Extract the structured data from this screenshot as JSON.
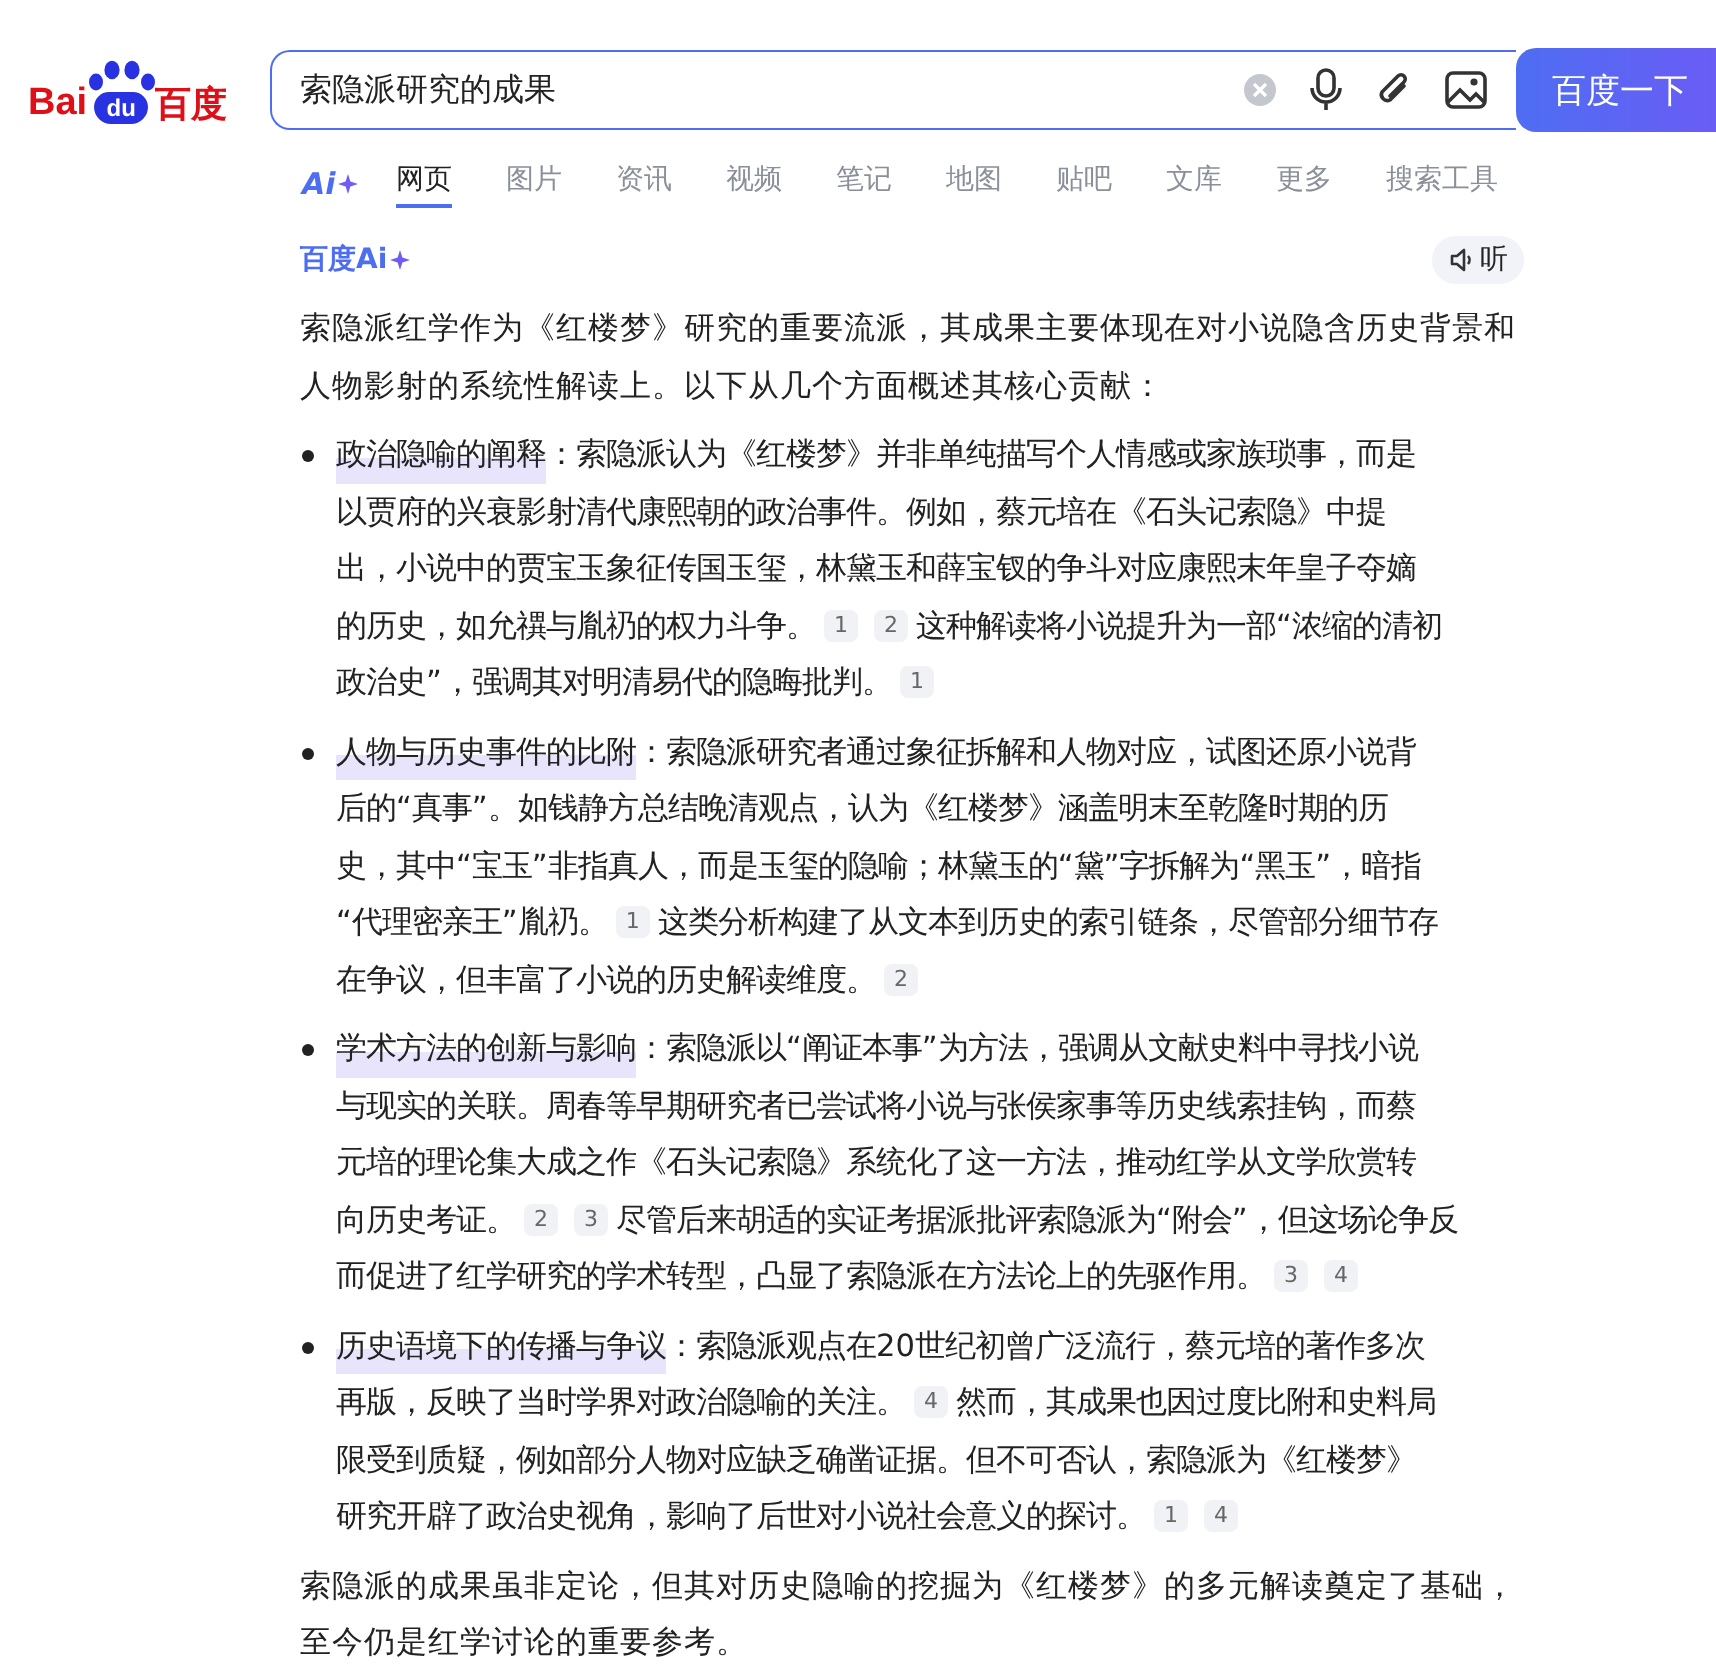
{
  "logo": {
    "left": "Bai",
    "paw": "du",
    "right": "百度"
  },
  "search": {
    "value": "索隐派研究的成果",
    "button": "百度一下"
  },
  "ai_tab": "Ai",
  "tabs": [
    {
      "label": "网页",
      "selected": true
    },
    {
      "label": "图片",
      "selected": false
    },
    {
      "label": "资讯",
      "selected": false
    },
    {
      "label": "视频",
      "selected": false
    },
    {
      "label": "笔记",
      "selected": false
    },
    {
      "label": "地图",
      "selected": false
    },
    {
      "label": "贴吧",
      "selected": false
    },
    {
      "label": "文库",
      "selected": false
    },
    {
      "label": "更多",
      "selected": false
    },
    {
      "label": "搜索工具",
      "selected": false
    }
  ],
  "answer": {
    "brand": "百度Ai",
    "listen": "听",
    "intro": "索隐派红学作为《红楼梦》研究的重要流派，其成果主要体现在对小说隐含历史背景和人物影射的系统性解读上。以下从几个方面概述其核心贡献：",
    "points": [
      {
        "lines": [
          [
            {
              "kind": "title",
              "text": "政治隐喻的阐释"
            },
            {
              "kind": "text",
              "text": "：索隐派认为《红楼梦》并非单纯描写个人情感或家族琐事，而是"
            }
          ],
          [
            {
              "kind": "text",
              "text": "以贾府的兴衰影射清代康熙朝的政治事件。例如，蔡元培在《石头记索隐》中提"
            }
          ],
          [
            {
              "kind": "text",
              "text": "出，小说中的贾宝玉象征传国玉玺，林黛玉和薛宝钗的争斗对应康熙末年皇子夺嫡"
            }
          ],
          [
            {
              "kind": "text",
              "text": "的历史，如允禩与胤礽的权力斗争。"
            },
            {
              "kind": "cite",
              "text": "1"
            },
            {
              "kind": "cite",
              "text": "2"
            },
            {
              "kind": "text",
              "text": "这种解读将小说提升为一部“浓缩的清初"
            }
          ],
          [
            {
              "kind": "text",
              "text": "政治史”，强调其对明清易代的隐晦批判。"
            },
            {
              "kind": "cite",
              "text": "1"
            }
          ]
        ]
      },
      {
        "lines": [
          [
            {
              "kind": "title",
              "text": "人物与历史事件的比附"
            },
            {
              "kind": "text",
              "text": "：索隐派研究者通过象征拆解和人物对应，试图还原小说背"
            }
          ],
          [
            {
              "kind": "text",
              "text": "后的“真事”。如钱静方总结晚清观点，认为《红楼梦》涵盖明末至乾隆时期的历"
            }
          ],
          [
            {
              "kind": "text",
              "text": "史，其中“宝玉”非指真人，而是玉玺的隐喻；林黛玉的“黛”字拆解为“黑玉”，暗指"
            }
          ],
          [
            {
              "kind": "text",
              "text": "“代理密亲王”胤礽。"
            },
            {
              "kind": "cite",
              "text": "1"
            },
            {
              "kind": "text",
              "text": "这类分析构建了从文本到历史的索引链条，尽管部分细节存"
            }
          ],
          [
            {
              "kind": "text",
              "text": "在争议，但丰富了小说的历史解读维度。"
            },
            {
              "kind": "cite",
              "text": "2"
            }
          ]
        ]
      },
      {
        "lines": [
          [
            {
              "kind": "title",
              "text": "学术方法的创新与影响"
            },
            {
              "kind": "text",
              "text": "：索隐派以“阐证本事”为方法，强调从文献史料中寻找小说"
            }
          ],
          [
            {
              "kind": "text",
              "text": "与现实的关联。周春等早期研究者已尝试将小说与张侯家事等历史线索挂钩，而蔡"
            }
          ],
          [
            {
              "kind": "text",
              "text": "元培的理论集大成之作《石头记索隐》系统化了这一方法，推动红学从文学欣赏转"
            }
          ],
          [
            {
              "kind": "text",
              "text": "向历史考证。"
            },
            {
              "kind": "cite",
              "text": "2"
            },
            {
              "kind": "cite",
              "text": "3"
            },
            {
              "kind": "text",
              "text": "尽管后来胡适的实证考据派批评索隐派为“附会”，但这场论争反"
            }
          ],
          [
            {
              "kind": "text",
              "text": "而促进了红学研究的学术转型，凸显了索隐派在方法论上的先驱作用。"
            },
            {
              "kind": "cite",
              "text": "3"
            },
            {
              "kind": "cite",
              "text": "4"
            }
          ]
        ]
      },
      {
        "lines": [
          [
            {
              "kind": "title",
              "text": "历史语境下的传播与争议"
            },
            {
              "kind": "text",
              "text": "：索隐派观点在20世纪初曾广泛流行，蔡元培的著作多次"
            }
          ],
          [
            {
              "kind": "text",
              "text": "再版，反映了当时学界对政治隐喻的关注。"
            },
            {
              "kind": "cite",
              "text": "4"
            },
            {
              "kind": "text",
              "text": "然而，其成果也因过度比附和史料局"
            }
          ],
          [
            {
              "kind": "text",
              "text": "限受到质疑，例如部分人物对应缺乏确凿证据。但不可否认，索隐派为《红楼梦》"
            }
          ],
          [
            {
              "kind": "text",
              "text": "研究开辟了政治史视角，影响了后世对小说社会意义的探讨。"
            },
            {
              "kind": "cite",
              "text": "1"
            },
            {
              "kind": "cite",
              "text": "4"
            }
          ]
        ]
      }
    ],
    "conclusion": "索隐派的成果虽非定论，但其对历史隐喻的挖掘为《红楼梦》的多元解读奠定了基础，至今仍是红学讨论的重要参考。"
  }
}
